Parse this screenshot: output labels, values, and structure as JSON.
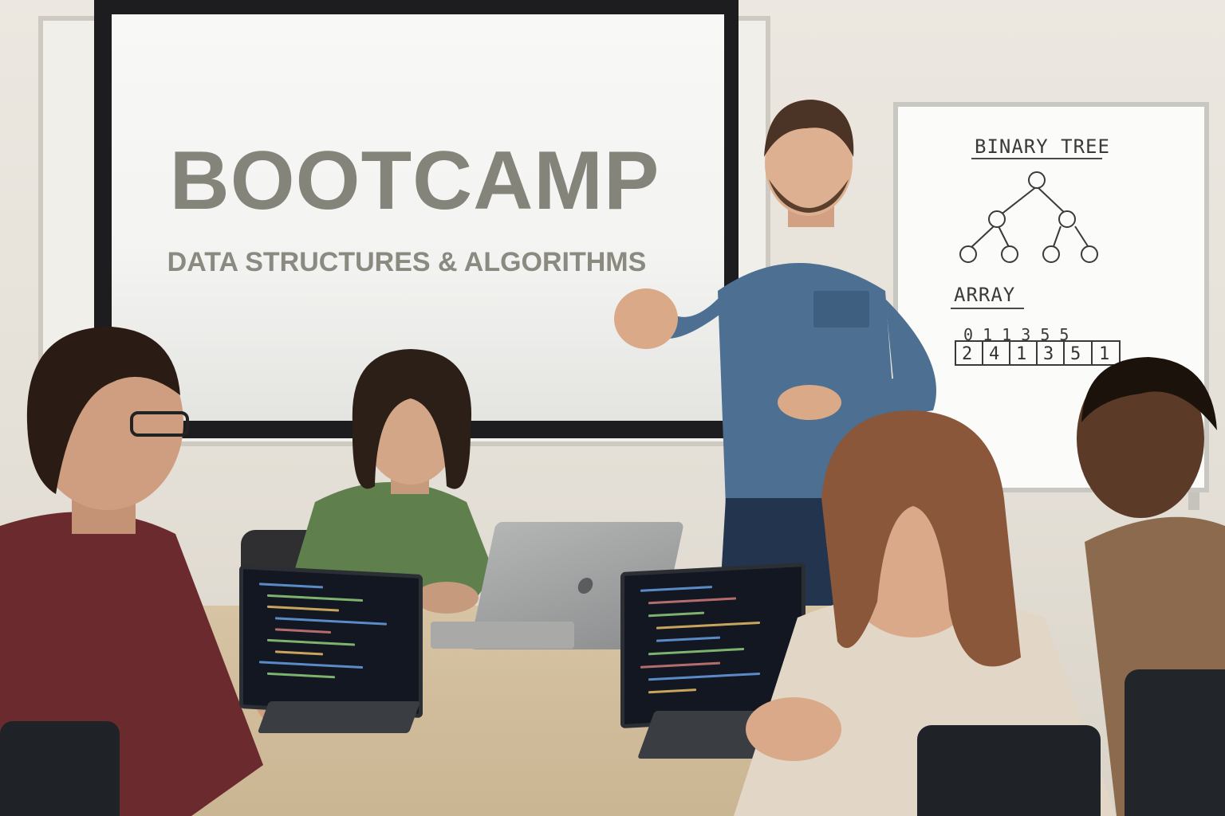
{
  "presentation": {
    "title": "BOOTCAMP",
    "subtitle": "DATA STRUCTURES & ALGORITHMS"
  },
  "whiteboard": {
    "tree_label": "BINARY TREE",
    "array_label": "ARRAY",
    "array_indices": "0  1  1  3  5  5",
    "array_values": [
      "2",
      "4",
      "1",
      "3",
      "5",
      "1"
    ]
  },
  "colors": {
    "screen_text": "#84847a",
    "instructor_shirt": "#4d6f91",
    "student_green_shirt": "#5f7f4d",
    "student_maroon_shirt": "#6b2a2e",
    "student_beige_sweater": "#e2d6c6",
    "student_brown_shirt": "#8b6a4d",
    "table_wood": "#d7c4a4"
  }
}
